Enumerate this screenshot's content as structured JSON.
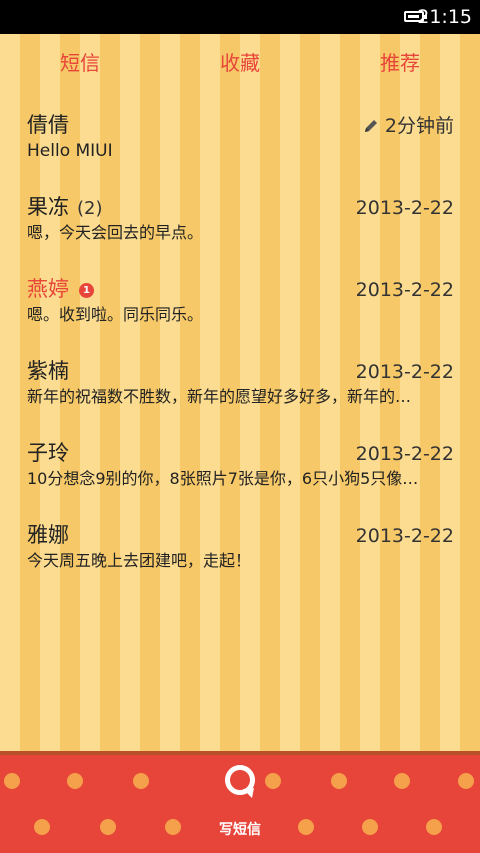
{
  "status_bar": {
    "time": "21:15",
    "battery_level": 0.8
  },
  "tabs": [
    {
      "label": "短信"
    },
    {
      "label": "收藏"
    },
    {
      "label": "推荐"
    }
  ],
  "threads": [
    {
      "name": "倩倩",
      "count": "",
      "date": "2分钟前",
      "preview": "Hello MIUI",
      "unread_badge": "",
      "draft": true
    },
    {
      "name": "果冻",
      "count": "(2)",
      "date": "2013-2-22",
      "preview": "嗯，今天会回去的早点。",
      "unread_badge": ""
    },
    {
      "name": "燕婷",
      "count": "",
      "date": "2013-2-22",
      "preview": "嗯。收到啦。同乐同乐。",
      "unread_badge": "1"
    },
    {
      "name": "紫楠",
      "count": "",
      "date": "2013-2-22",
      "preview": "新年的祝福数不胜数，新年的愿望好多好多，新年的…",
      "unread_badge": ""
    },
    {
      "name": "子玲",
      "count": "",
      "date": "2013-2-22",
      "preview": "10分想念9别的你，8张照片7张是你，6只小狗5只像…",
      "unread_badge": ""
    },
    {
      "name": "雅娜",
      "count": "",
      "date": "2013-2-22",
      "preview": "今天周五晚上去团建吧，走起！",
      "unread_badge": ""
    }
  ],
  "compose": {
    "label": "写短信"
  },
  "colors": {
    "accent": "#e8453a",
    "stripe_light": "#fbdc90",
    "stripe_dark": "#f6c868",
    "dot": "#f5a04a"
  }
}
